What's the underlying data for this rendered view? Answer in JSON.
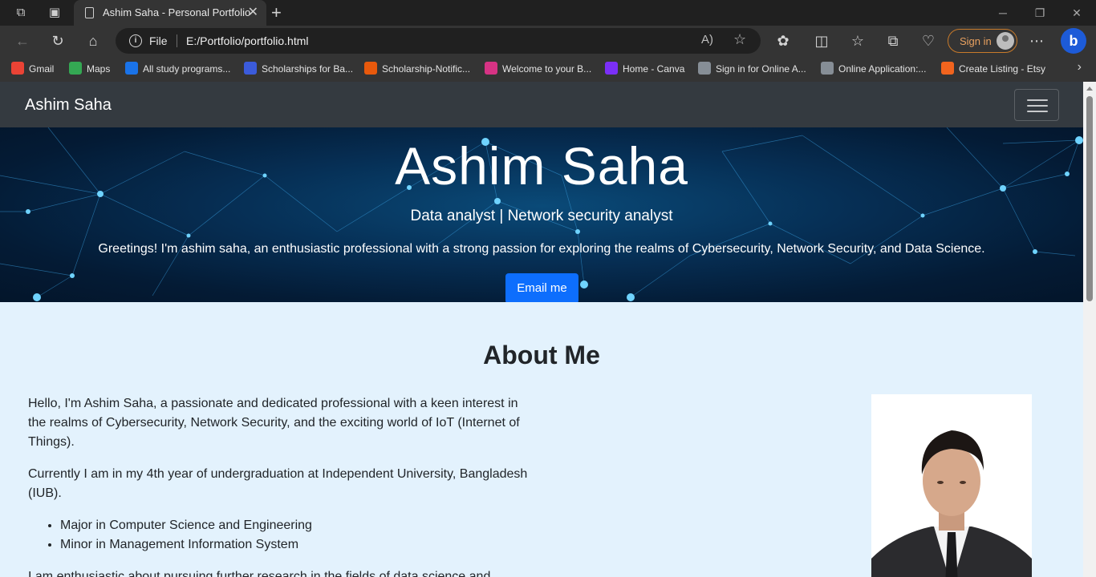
{
  "browser": {
    "tab_title": "Ashim Saha - Personal Portfolio",
    "scheme_label": "File",
    "url": "E:/Portfolio/portfolio.html",
    "sign_in_label": "Sign in",
    "bookmarks": [
      {
        "label": "Gmail",
        "icon": "gmail-icon",
        "color": "#ea4335"
      },
      {
        "label": "Maps",
        "icon": "maps-icon",
        "color": "#34a853"
      },
      {
        "label": "All study programs...",
        "icon": "d-icon",
        "color": "#1a73e8"
      },
      {
        "label": "Scholarships for Ba...",
        "icon": "scholar-icon",
        "color": "#3b5bdb"
      },
      {
        "label": "Scholarship-Notific...",
        "icon": "notice-icon",
        "color": "#e8590c"
      },
      {
        "label": "Welcome to your B...",
        "icon": "welcome-icon",
        "color": "#d63384"
      },
      {
        "label": "Home - Canva",
        "icon": "canva-icon",
        "color": "#7b2ff7"
      },
      {
        "label": "Sign in for Online A...",
        "icon": "signin-site-icon",
        "color": "#868e96"
      },
      {
        "label": "Online Application:...",
        "icon": "application-icon",
        "color": "#868e96"
      },
      {
        "label": "Create Listing - Etsy",
        "icon": "etsy-icon",
        "color": "#f1641e"
      }
    ]
  },
  "page": {
    "brand": "Ashim Saha",
    "hero": {
      "title": "Ashim Saha",
      "subtitle": "Data analyst | Network security analyst",
      "lead": "Greetings! I'm ashim saha, an enthusiastic professional with a strong passion for exploring the realms of Cybersecurity, Network Security, and Data Science.",
      "button": "Email me"
    },
    "about": {
      "title": "About Me",
      "p1": "Hello, I'm Ashim Saha, a passionate and dedicated professional with a keen interest in the realms of Cybersecurity, Network Security, and the exciting world of IoT (Internet of Things).",
      "p2": "Currently I am in my 4th year of undergraduation at Independent University, Bangladesh (IUB).",
      "list": [
        "Major in Computer Science and Engineering",
        "Minor in Management Information System"
      ],
      "p3": "I am enthusiastic about pursuing further research in the fields of data science and"
    }
  },
  "colors": {
    "navbar": "#343a40",
    "primary_button": "#0d6efd",
    "page_background": "#e3f2fd",
    "signin_accent": "#e8a160"
  }
}
